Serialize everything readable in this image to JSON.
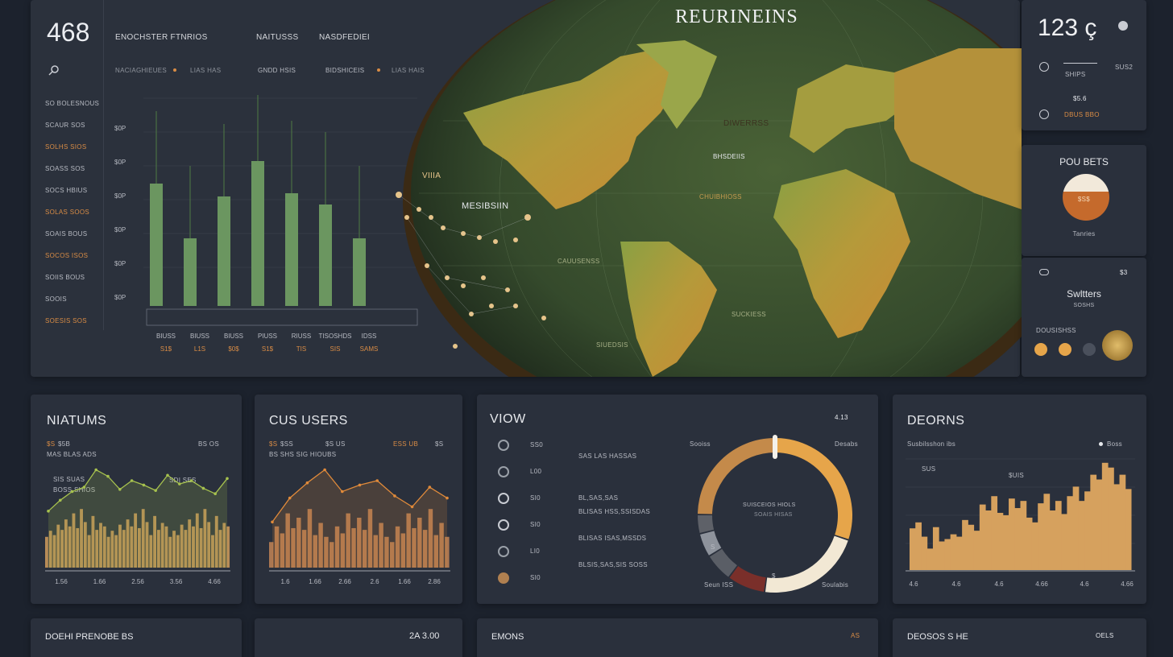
{
  "top_panel": {
    "big_number": "468",
    "header_labels": [
      "ENOCHSTER FTNRIOS",
      "NAITUSSS",
      "NASDFEDIEI"
    ],
    "sub_labels": [
      "NACIAGHIEUES",
      "LIAS HAS",
      "GNDD HSIS",
      "BIDSHICEIS",
      "LIAS HAIS"
    ],
    "rows": [
      "SO BOLESNOUS",
      "SCAUR SOS",
      "SOLHS SIOS",
      "SOASS SOS",
      "SOCS HBIUS",
      "SOLAS SOOS",
      "SOAIS BOUS",
      "SOCOS ISOS",
      "SOIIS BOUS",
      "SOOIS",
      "SOESIS SOS"
    ],
    "yticks": [
      "$0P",
      "$0P",
      "$0P",
      "$0P",
      "$0P",
      "$0P"
    ],
    "x_labels": [
      "BIUSS",
      "BIUSS",
      "BIUSS",
      "PIUSS",
      "RIUSS",
      "TISOSHDS",
      "IDSS"
    ],
    "x_values": [
      "S1$",
      "L1S",
      "$0$",
      "S1$",
      "TIS",
      "SIS",
      "SAMS"
    ]
  },
  "chart_data": [
    {
      "type": "bar",
      "title": "",
      "categories": [
        "BIUSS",
        "BIUSS",
        "BIUSS",
        "PIUSS",
        "RIUSS",
        "TISOSHDS",
        "IDSS"
      ],
      "values": [
        76,
        42,
        68,
        90,
        70,
        63,
        42
      ],
      "ylim": [
        0,
        100
      ]
    },
    {
      "type": "area",
      "title": "NIATUMS",
      "series": [
        {
          "values": [
            52,
            62,
            70,
            74,
            90,
            84,
            72,
            80,
            76,
            71,
            85,
            77,
            80,
            73,
            68,
            82
          ]
        },
        {
          "values": [
            28,
            35,
            30,
            42,
            36,
            48,
            40,
            55,
            38,
            60,
            45,
            30,
            52,
            36,
            44,
            40
          ]
        }
      ],
      "x": [
        "1.56",
        "1.66",
        "2.56",
        "3.56",
        "4.66"
      ],
      "ylim": [
        0,
        100
      ]
    },
    {
      "type": "area",
      "title": "CUS USERS",
      "series": [
        {
          "values": [
            42,
            64,
            78,
            90,
            70,
            76,
            80,
            66,
            56,
            74,
            64
          ]
        },
        {
          "values": [
            22,
            40,
            32,
            55,
            38,
            50,
            36,
            60,
            30,
            44,
            28
          ]
        }
      ],
      "x": [
        "1.6",
        "1.66",
        "2.66",
        "2.6",
        "1.66",
        "2.86"
      ],
      "ylim": [
        0,
        100
      ]
    },
    {
      "type": "pie",
      "title": "VIOW",
      "values": [
        30,
        22,
        8,
        6,
        5,
        4,
        25
      ]
    },
    {
      "type": "bar",
      "title": "DEORNS",
      "values": [
        35,
        40,
        28,
        18,
        36,
        24,
        26,
        30,
        28,
        42,
        38,
        33,
        55,
        50,
        62,
        48,
        46,
        60,
        52,
        58,
        44,
        40,
        56,
        64,
        50,
        58,
        47,
        62,
        70,
        58,
        66,
        80,
        76,
        90,
        86,
        72,
        80,
        68
      ],
      "x": [
        "4.6",
        "4.6",
        "4.6",
        "4.66",
        "4.6",
        "4.66"
      ],
      "ylim": [
        0,
        100
      ]
    }
  ],
  "map": {
    "title": "REURINEINS",
    "labels": [
      "VIIIA",
      "MESIBSIIN",
      "DIWERRSS",
      "BHSDEIIS",
      "CHUIBHIOSS",
      "CAUUSENSS",
      "SUCKIESS",
      "SIUEDSIS"
    ]
  },
  "right_top": {
    "number": "123 ç",
    "label1": "SHIPS",
    "value1": "SUS2",
    "value2": "$5.6",
    "label2": "DBUS BBO"
  },
  "right_mid": {
    "title": "POU BETS",
    "value": "$S$",
    "label": "Tanries"
  },
  "right_low": {
    "value": "$3",
    "title": "Swltters",
    "sub": "SOSHS",
    "label": "DOUSISHSS"
  },
  "niatums": {
    "title": "NIATUMS",
    "l1": "$S",
    "l2": "$5B",
    "l3": "BS OS",
    "l4": "MAS BLAS ADS",
    "l5": "SIS SUAS",
    "l6": "BOSS SHIOS",
    "l7": "SDI SES"
  },
  "cususers": {
    "title": "CUS USERS",
    "l1": "$S",
    "l2": "$SS",
    "l3": "$S US",
    "l4": "BS SHS SIG HIOUBS",
    "l5": "ESS UB",
    "l6": "$S"
  },
  "viow": {
    "title": "VIOW",
    "value": "4.13",
    "rows": [
      {
        "num": "SS0",
        "text": "SAS LAS HASSAS"
      },
      {
        "num": "L00",
        "text": ""
      },
      {
        "num": "SI0",
        "text": "BL,SAS,SAS"
      },
      {
        "num": "SI0",
        "text": "BLISAS HSS,SSISDAS"
      },
      {
        "num": "LI0",
        "text": "BLISAS ISAS,MSSDS"
      },
      {
        "num": "SI0",
        "text": "BLSIS,SAS,SIS SOSS"
      }
    ],
    "donut_labels": [
      "Sooiss",
      "Desabs",
      "SUISCEIOS HIOLS",
      "SOAIS HISAS",
      "S",
      "Seun ISS",
      "Soulabis",
      "$"
    ]
  },
  "deorns": {
    "title": "DEORNS",
    "l1": "Susbilsshon ibs",
    "l2": "Boss",
    "l3": "SUS",
    "l4": "$UIS"
  },
  "bottom_row": {
    "p1": "DOEHI PRENOBE BS",
    "p2": "2A 3.00",
    "p3": "EMONS",
    "p3b": "AS",
    "p4": "DEOSOS S HE",
    "p4b": "OELS"
  },
  "colors": {
    "accent": "#d98c45",
    "green": "#5f8a55",
    "gold": "#e6a54a"
  }
}
